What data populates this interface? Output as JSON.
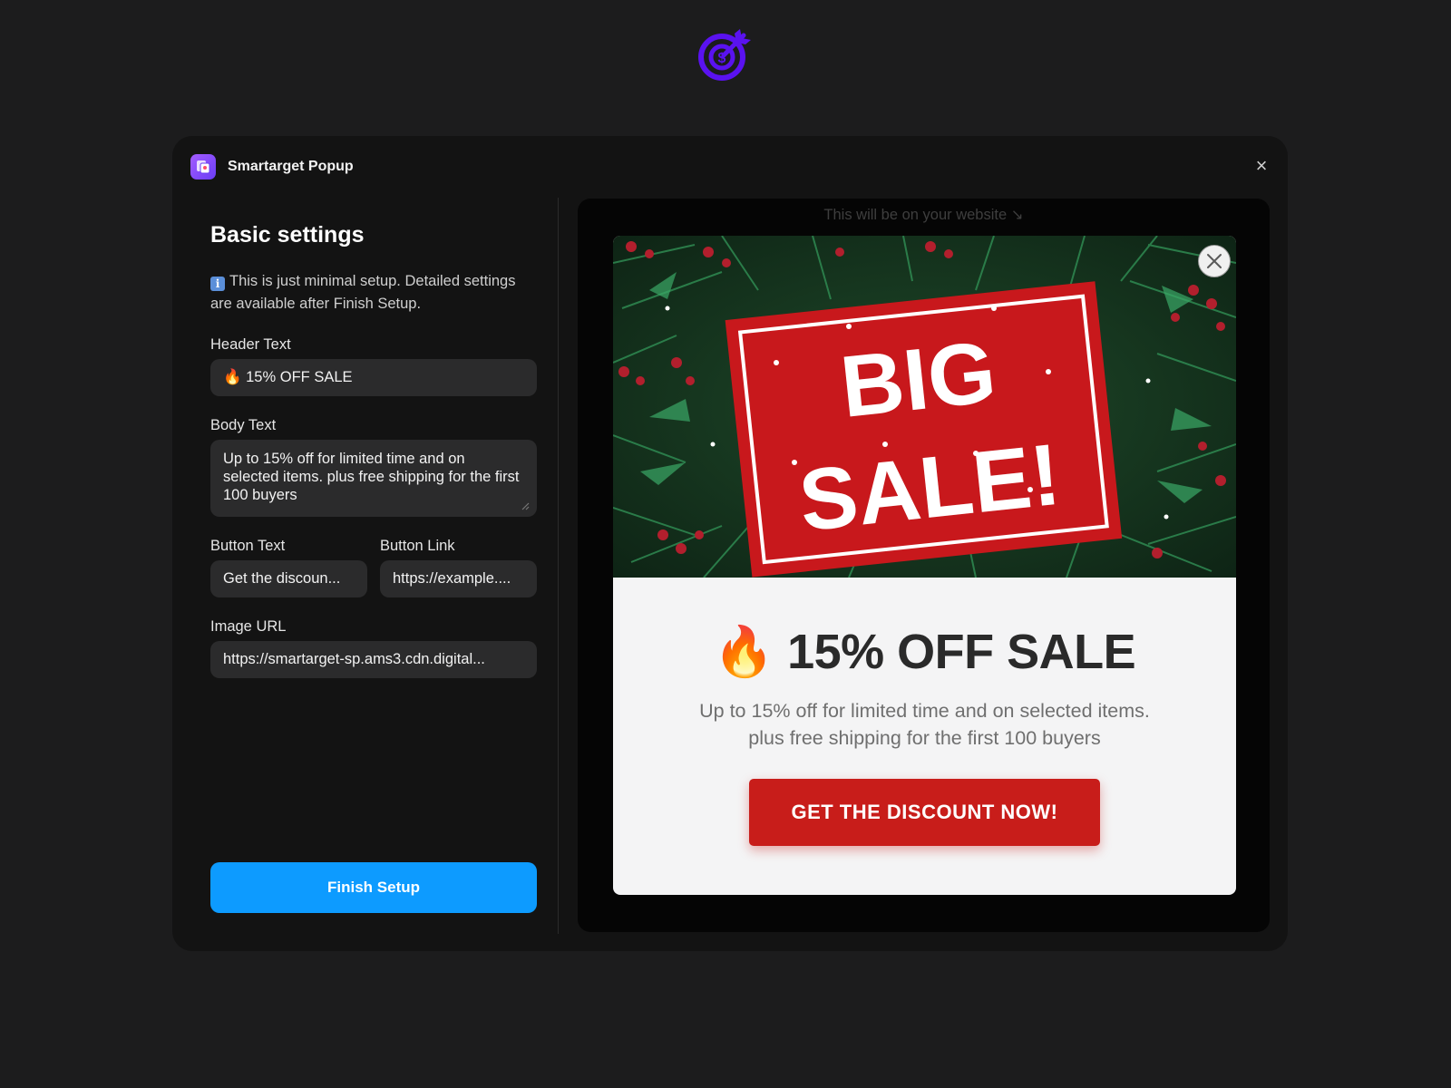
{
  "app": {
    "title": "Smartarget Popup",
    "logo_icon": "target-dollar-icon",
    "accent_color": "#5a12f0"
  },
  "settings": {
    "section_title": "Basic settings",
    "info_icon": "information-icon",
    "info_text": "This is just minimal setup. Detailed settings are available after Finish Setup.",
    "header_text_label": "Header Text",
    "header_text_value": "🔥 15% OFF SALE",
    "body_text_label": "Body Text",
    "body_text_value": "Up to 15% off for limited time and on selected items. plus free shipping for the first 100 buyers",
    "button_text_label": "Button Text",
    "button_text_value": "Get the discoun...",
    "button_link_label": "Button Link",
    "button_link_value": "https://example....",
    "image_url_label": "Image URL",
    "image_url_value": "https://smartarget-sp.ams3.cdn.digital...",
    "finish_label": "Finish Setup",
    "finish_color": "#0d9bff"
  },
  "preview": {
    "note": "This will be on your website ↘",
    "image_text_line1": "BIG",
    "image_text_line2": "SALE!",
    "headline": "🔥 15% OFF SALE",
    "body_line1": "Up to 15% off for limited time and on selected items.",
    "body_line2": "plus free shipping for the first 100 buyers",
    "cta_label": "GET THE DISCOUNT NOW!",
    "cta_color": "#c81d1a"
  }
}
